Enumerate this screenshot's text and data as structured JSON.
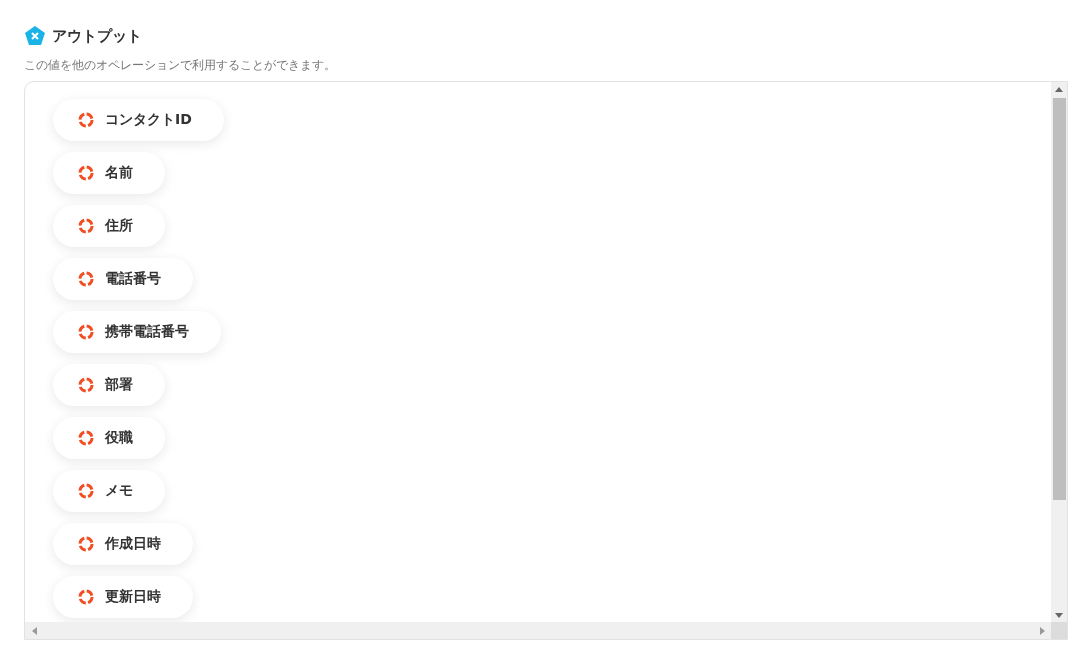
{
  "section": {
    "title": "アウトプット",
    "description": "この値を他のオペレーションで利用することができます。"
  },
  "outputs": [
    {
      "label": "コンタクトID"
    },
    {
      "label": "名前"
    },
    {
      "label": "住所"
    },
    {
      "label": "電話番号"
    },
    {
      "label": "携帯電話番号"
    },
    {
      "label": "部署"
    },
    {
      "label": "役職"
    },
    {
      "label": "メモ"
    },
    {
      "label": "作成日時"
    },
    {
      "label": "更新日時"
    }
  ]
}
